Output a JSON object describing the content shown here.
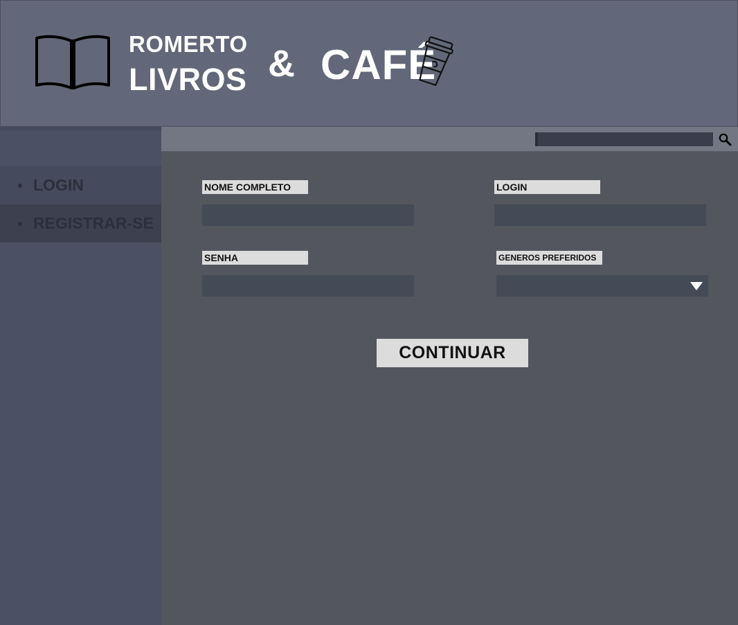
{
  "header": {
    "brand_line1": "ROMERTO",
    "brand_line2": "LIVROS",
    "ampersand": "&",
    "cafe": "CAFÉ",
    "logo_icon": "open-book-icon",
    "cup_icon": "coffee-cup-icon"
  },
  "sidebar": {
    "items": [
      {
        "label": "LOGIN"
      },
      {
        "label": "REGISTRAR-SE"
      }
    ]
  },
  "search": {
    "value": "",
    "placeholder": "",
    "icon": "search-icon"
  },
  "form": {
    "fields": [
      {
        "label": "NOME COMPLETO",
        "value": ""
      },
      {
        "label": "LOGIN",
        "value": ""
      },
      {
        "label": "SENHA",
        "value": ""
      },
      {
        "label": "GENEROS PREFERIDOS",
        "value": ""
      }
    ],
    "submit_label": "CONTINUAR"
  },
  "colors": {
    "header_bg": "#626879",
    "sidebar_bg": "#4c5064",
    "content_bg": "#54565e",
    "label_bg": "#dcdcdc",
    "input_bg": "#454a57",
    "text_light": "#ffffff"
  }
}
